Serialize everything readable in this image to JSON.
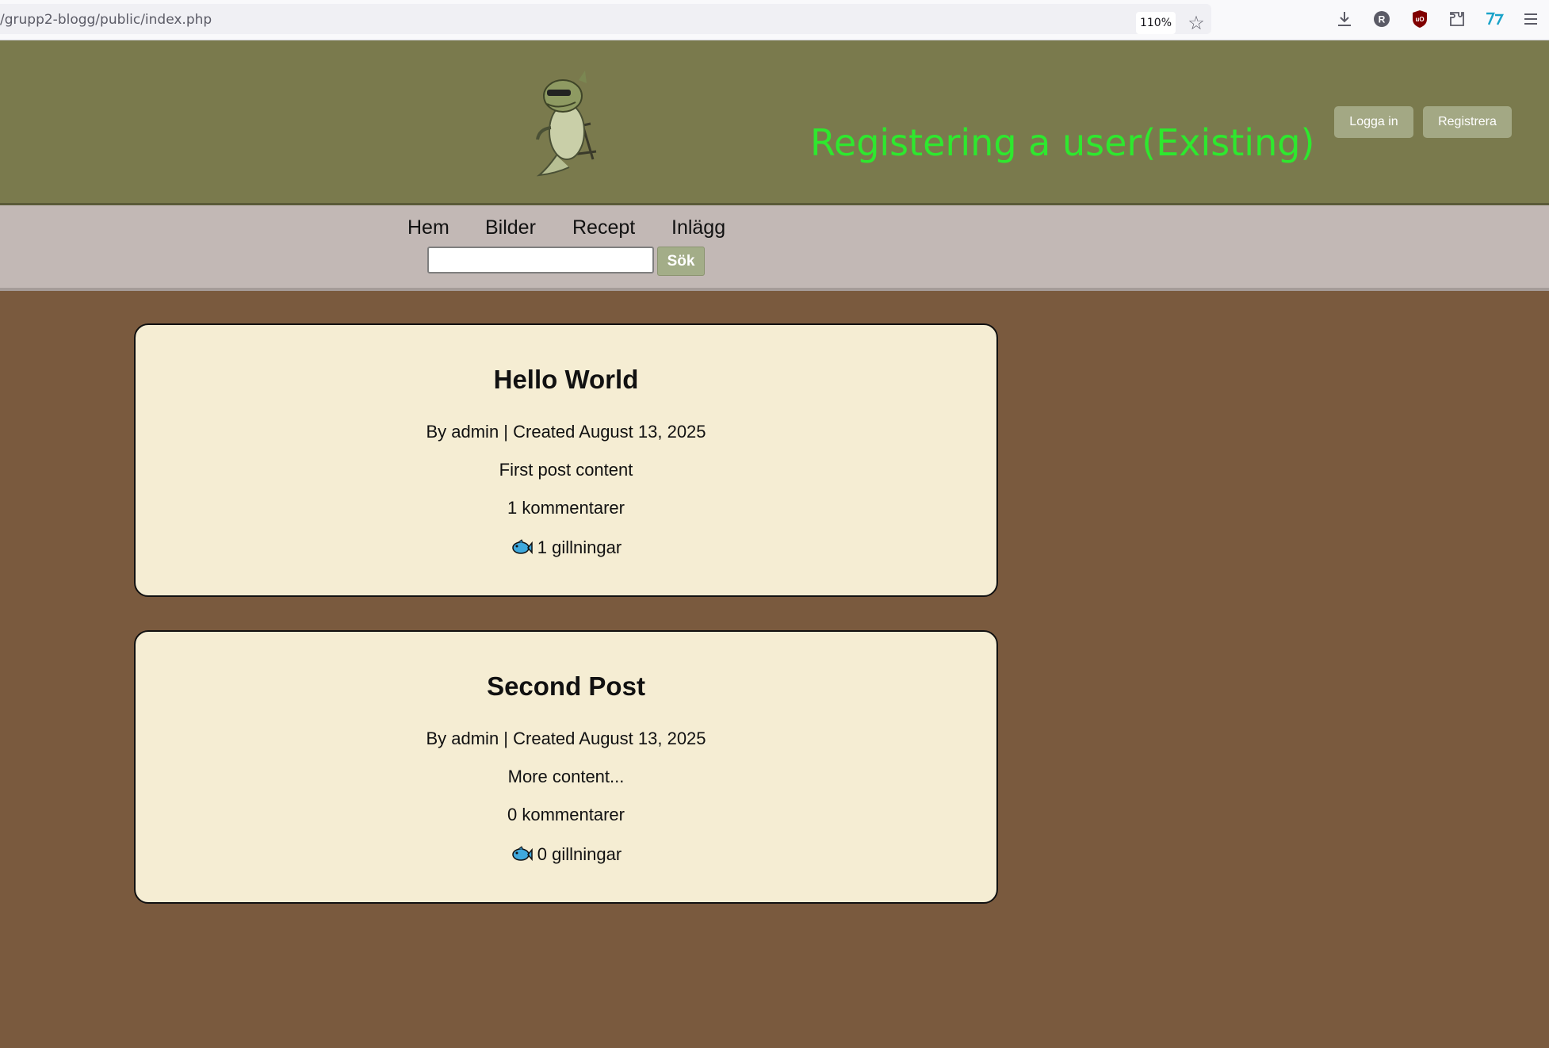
{
  "browser": {
    "url": "/grupp2-blogg/public/index.php",
    "zoom": "110%"
  },
  "header": {
    "title": "Registering a user(Existing)",
    "login_label": "Logga in",
    "register_label": "Registrera"
  },
  "nav": {
    "items": [
      {
        "label": "Hem"
      },
      {
        "label": "Bilder"
      },
      {
        "label": "Recept"
      },
      {
        "label": "Inlägg"
      }
    ],
    "search": {
      "placeholder": "",
      "value": "",
      "button_label": "Sök"
    }
  },
  "posts": [
    {
      "title": "Hello World",
      "meta": "By admin | Created August 13, 2025",
      "content": "First post content",
      "comments": "1 kommentarer",
      "likes": "1 gillningar"
    },
    {
      "title": "Second Post",
      "meta": "By admin | Created August 13, 2025",
      "content": "More content...",
      "comments": "0 kommentarer",
      "likes": "0 gillningar"
    }
  ],
  "colors": {
    "page_bg": "#7a5a3e",
    "header_bg": "#7a7a4d",
    "title": "#2ee82e",
    "nav_bg": "#c2b8b5",
    "post_bg": "#f5edd3"
  },
  "icons": [
    "star-icon",
    "download-icon",
    "profile-icon",
    "ublock-icon",
    "extensions-icon",
    "translate-icon",
    "menu-icon",
    "fish-icon"
  ]
}
